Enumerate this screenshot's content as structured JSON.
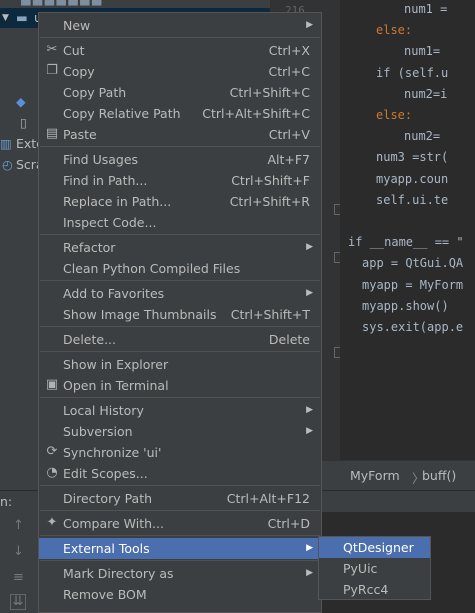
{
  "project_tree": [
    {
      "label": "ui",
      "selected": true
    },
    {
      "label": "Exte"
    },
    {
      "label": "Scra"
    }
  ],
  "line_number_top": "216",
  "editor_lines": [
    {
      "t": "num1 = ",
      "kind": "plain",
      "indent": 4
    },
    {
      "t": "else:",
      "kind": "kw",
      "indent": 2
    },
    {
      "t": "num1=",
      "kind": "plain",
      "indent": 4
    },
    {
      "t": "if (self.u",
      "kind": "if",
      "indent": 2
    },
    {
      "t": "num2=i",
      "kind": "plain",
      "indent": 4
    },
    {
      "t": "else:",
      "kind": "kw",
      "indent": 2
    },
    {
      "t": "num2=",
      "kind": "plain",
      "indent": 4
    },
    {
      "t": "num3 =str(",
      "kind": "plain",
      "indent": 2
    },
    {
      "t": "myapp.coun",
      "kind": "plain",
      "indent": 2
    },
    {
      "t": "self.ui.te",
      "kind": "self",
      "indent": 2
    },
    {
      "t": "",
      "kind": "plain",
      "indent": 0
    },
    {
      "t": "if __name__ == \"",
      "kind": "main",
      "indent": 0
    },
    {
      "t": "app = QtGui.QA",
      "kind": "plain",
      "indent": 1
    },
    {
      "t": "myapp = MyForm",
      "kind": "plain",
      "indent": 1
    },
    {
      "t": "myapp.show()",
      "kind": "plain",
      "indent": 1
    },
    {
      "t": "sys.exit(app.e",
      "kind": "plain",
      "indent": 1
    }
  ],
  "breadcrumbs": [
    "MyForm",
    "buff()"
  ],
  "run_label": "n:",
  "menu": [
    {
      "label": "New",
      "submenu": true
    },
    {
      "sep": true
    },
    {
      "label": "Cut",
      "shortcut": "Ctrl+X",
      "icon": "scissors-icon",
      "glyph": "✂"
    },
    {
      "label": "Copy",
      "shortcut": "Ctrl+C",
      "icon": "copy-icon",
      "glyph": "❐"
    },
    {
      "label": "Copy Path",
      "shortcut": "Ctrl+Shift+C"
    },
    {
      "label": "Copy Relative Path",
      "shortcut": "Ctrl+Alt+Shift+C"
    },
    {
      "label": "Paste",
      "shortcut": "Ctrl+V",
      "icon": "paste-icon",
      "glyph": "▤"
    },
    {
      "sep": true
    },
    {
      "label": "Find Usages",
      "shortcut": "Alt+F7"
    },
    {
      "label": "Find in Path...",
      "shortcut": "Ctrl+Shift+F"
    },
    {
      "label": "Replace in Path...",
      "shortcut": "Ctrl+Shift+R"
    },
    {
      "label": "Inspect Code..."
    },
    {
      "sep": true
    },
    {
      "label": "Refactor",
      "submenu": true
    },
    {
      "label": "Clean Python Compiled Files"
    },
    {
      "sep": true
    },
    {
      "label": "Add to Favorites",
      "submenu": true
    },
    {
      "label": "Show Image Thumbnails",
      "shortcut": "Ctrl+Shift+T"
    },
    {
      "sep": true
    },
    {
      "label": "Delete...",
      "shortcut": "Delete"
    },
    {
      "sep": true
    },
    {
      "label": "Show in Explorer"
    },
    {
      "label": "Open in Terminal",
      "icon": "terminal-icon",
      "glyph": "▣"
    },
    {
      "sep": true
    },
    {
      "label": "Local History",
      "submenu": true
    },
    {
      "label": "Subversion",
      "submenu": true
    },
    {
      "label": "Synchronize 'ui'",
      "icon": "sync-icon",
      "glyph": "⟳"
    },
    {
      "label": "Edit Scopes...",
      "icon": "scopes-icon",
      "glyph": "◔"
    },
    {
      "sep": true
    },
    {
      "label": "Directory Path",
      "shortcut": "Ctrl+Alt+F12"
    },
    {
      "sep": true
    },
    {
      "label": "Compare With...",
      "shortcut": "Ctrl+D",
      "icon": "compare-icon",
      "glyph": "✦"
    },
    {
      "sep": true
    },
    {
      "label": "External Tools",
      "submenu": true,
      "highlighted": true
    },
    {
      "sep": true
    },
    {
      "label": "Mark Directory as",
      "submenu": true
    },
    {
      "label": "Remove BOM"
    }
  ],
  "submenu_external_tools": [
    {
      "label": "QtDesigner",
      "highlighted": true
    },
    {
      "label": "PyUic"
    },
    {
      "label": "PyRcc4"
    }
  ],
  "colors": {
    "menu_bg": "#3c3f41",
    "highlight": "#4b6eaf",
    "editor_bg": "#2b2b2b"
  }
}
